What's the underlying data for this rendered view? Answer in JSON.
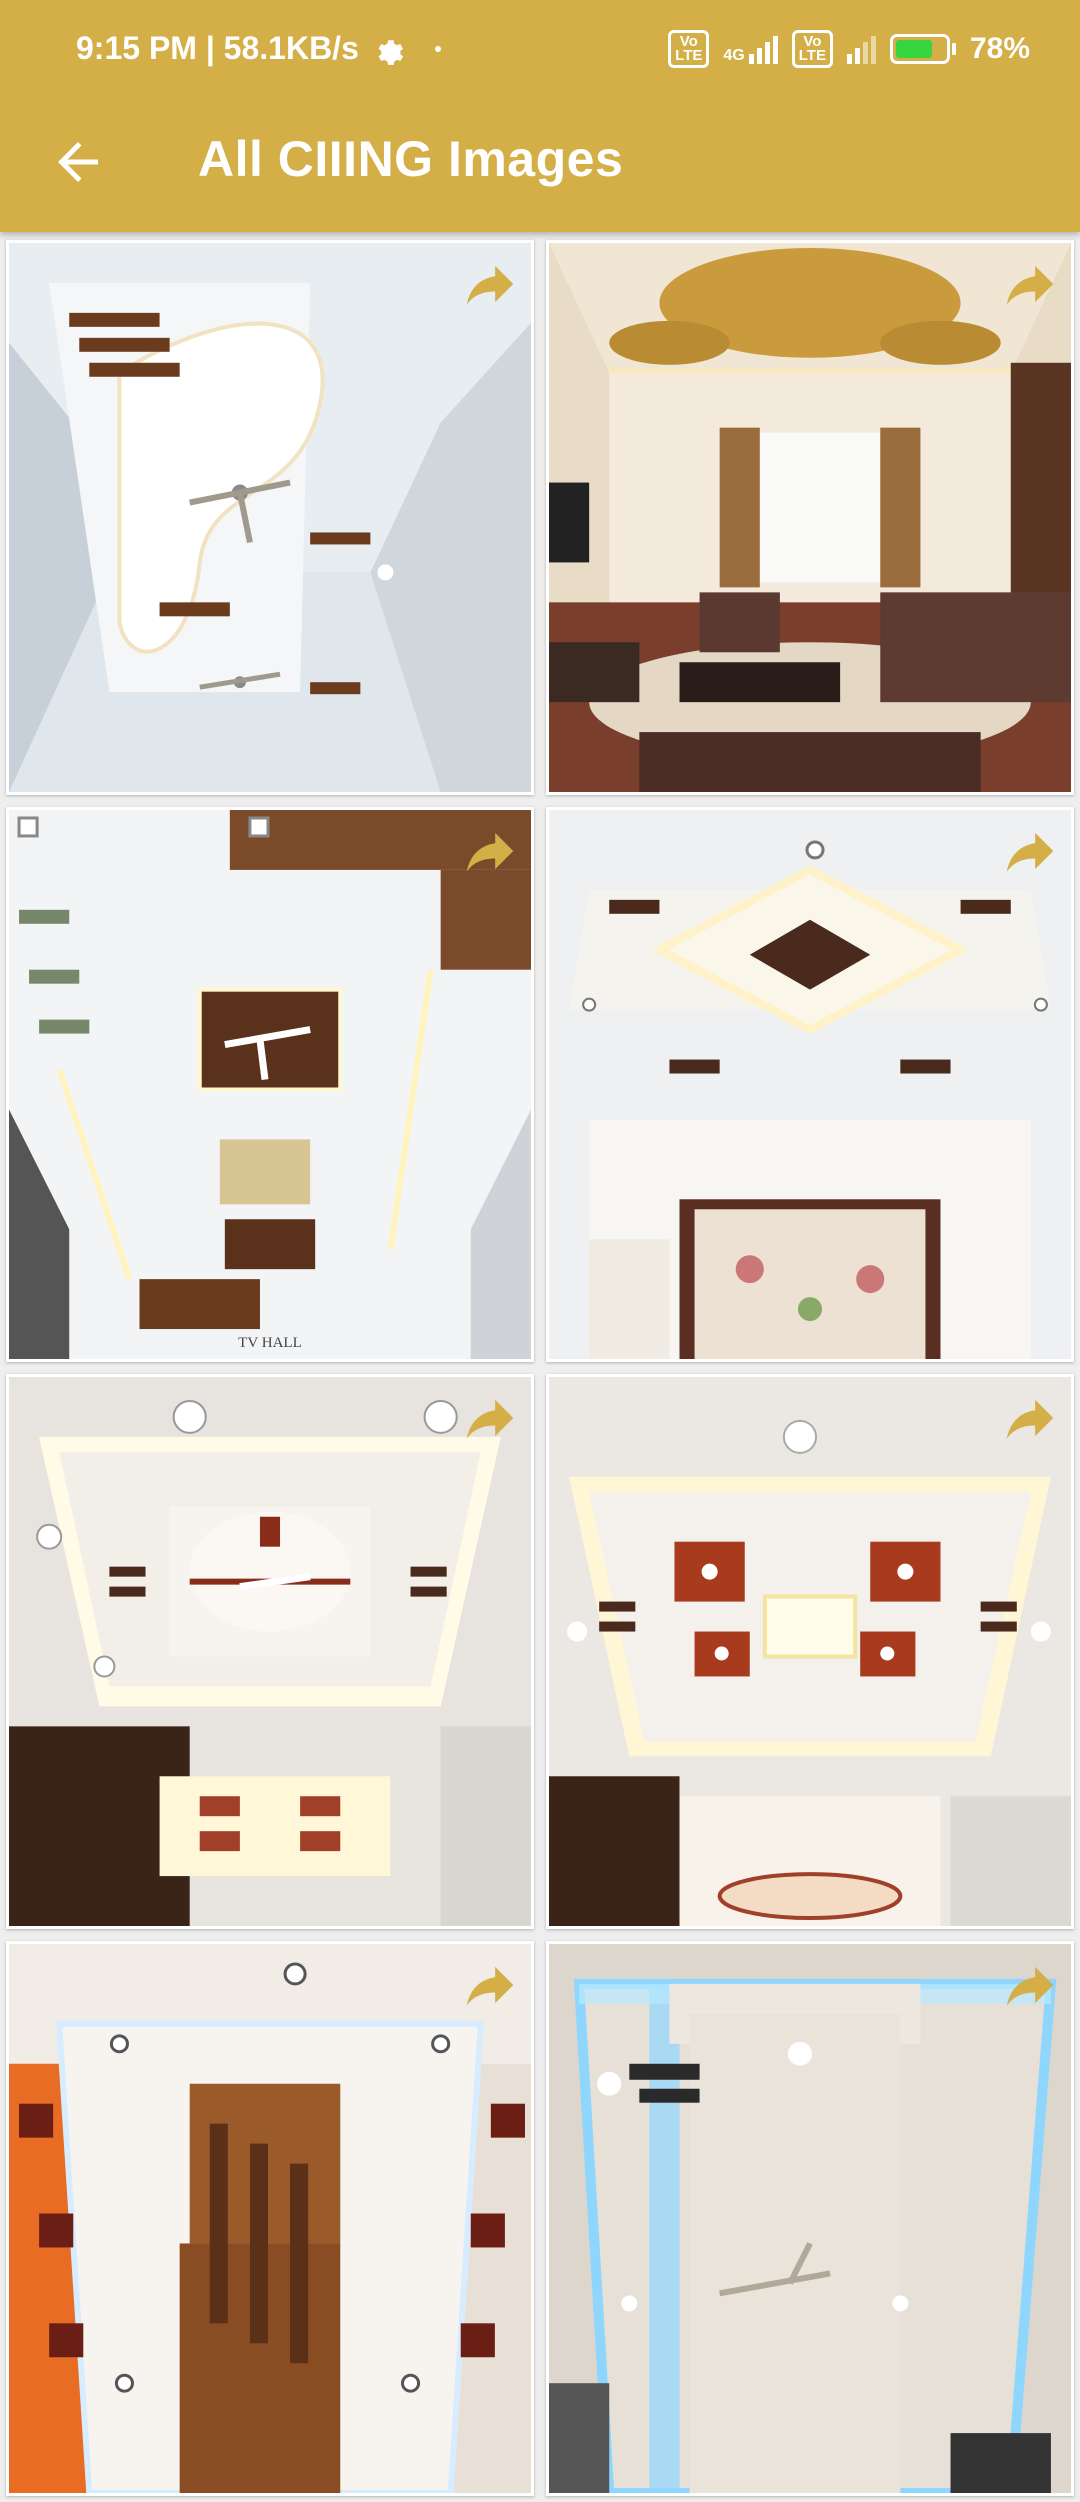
{
  "status_bar": {
    "time_speed": "9:15 PM | 58.1KB/s",
    "volte1": "Vo LTE",
    "network": "4G",
    "volte2": "Vo LTE",
    "battery": "78%",
    "battery_level": 0.78
  },
  "toolbar": {
    "title": "All CIIING Images"
  },
  "colors": {
    "accent": "#d4ae46",
    "share_icon": "#d4ae46"
  },
  "images": [
    {
      "label": "",
      "caption": ""
    },
    {
      "label": "",
      "caption": ""
    },
    {
      "label": "",
      "caption": "TV HALL"
    },
    {
      "label": "",
      "caption": ""
    },
    {
      "label": "",
      "caption": ""
    },
    {
      "label": "",
      "caption": ""
    },
    {
      "label": "",
      "caption": ""
    },
    {
      "label": "",
      "caption": ""
    }
  ]
}
